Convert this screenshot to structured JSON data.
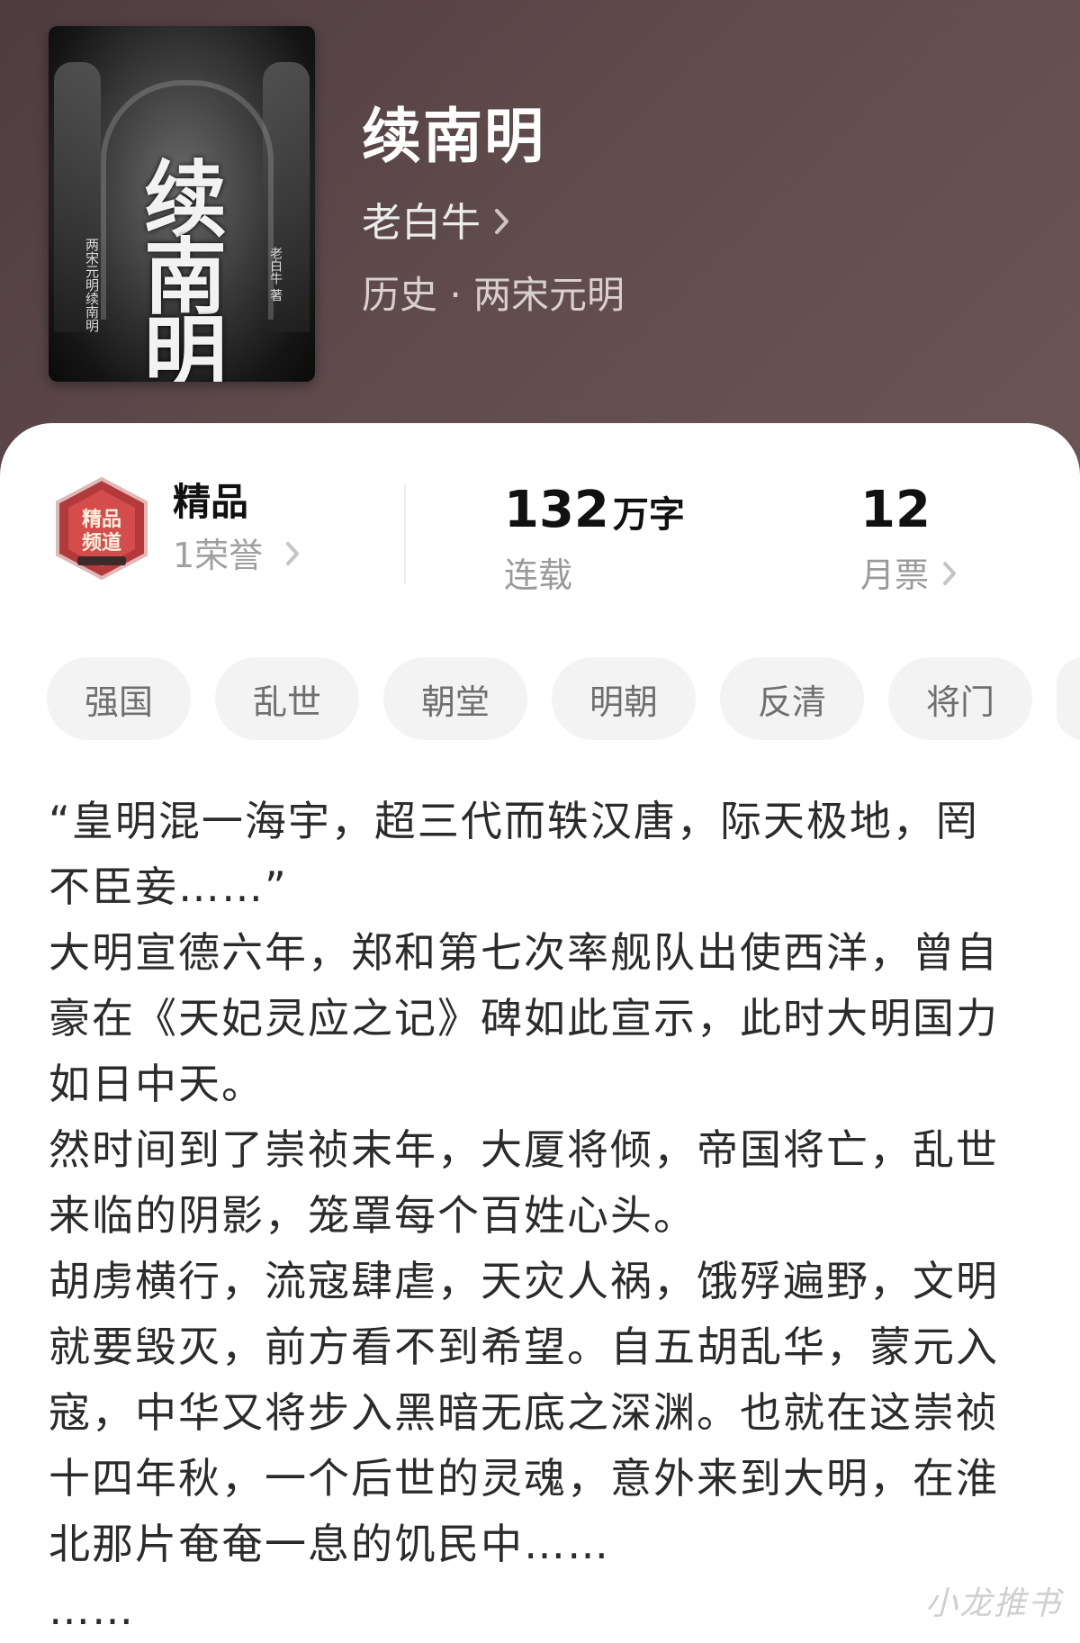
{
  "book": {
    "title": "续南明",
    "author": "老白牛",
    "category": "历史 · 两宋元明",
    "cover": {
      "title_text": "续南明",
      "subtitle_text": "两宋元明续南明",
      "author_text": "老白牛 著"
    }
  },
  "stats": {
    "premium_label": "精品",
    "honor_label": "1荣誉",
    "word_count": "132",
    "word_unit": "万字",
    "status": "连载",
    "monthly_tickets": "12",
    "monthly_tickets_label": "月票"
  },
  "tags": [
    "强国",
    "乱世",
    "朝堂",
    "明朝",
    "反清",
    "将门"
  ],
  "description": [
    "“皇明混一海宇，超三代而轶汉唐，际天极地，罔不臣妾……”",
    "大明宣德六年，郑和第七次率舰队出使西洋，曾自豪在《天妃灵应之记》碑如此宣示，此时大明国力如日中天。",
    "然时间到了崇祯末年，大厦将倾，帝国将亡，乱世来临的阴影，笼罩每个百姓心头。",
    "胡虏横行，流寇肆虐，天灾人祸，饿殍遍野，文明就要毁灭，前方看不到希望。自五胡乱华，蒙元入寇，中华又将步入黑暗无底之深渊。也就在这崇祯十四年秋，一个后世的灵魂，意外来到大明，在淮北那片奄奄一息的饥民中……",
    "……"
  ],
  "watermark": "小龙推书",
  "colors": {
    "header_bg": "#5a4648",
    "badge_red": "#c0392b",
    "tag_bg": "#f3f3f3"
  },
  "icons": [
    "chevron-right-icon",
    "premium-badge-icon"
  ]
}
